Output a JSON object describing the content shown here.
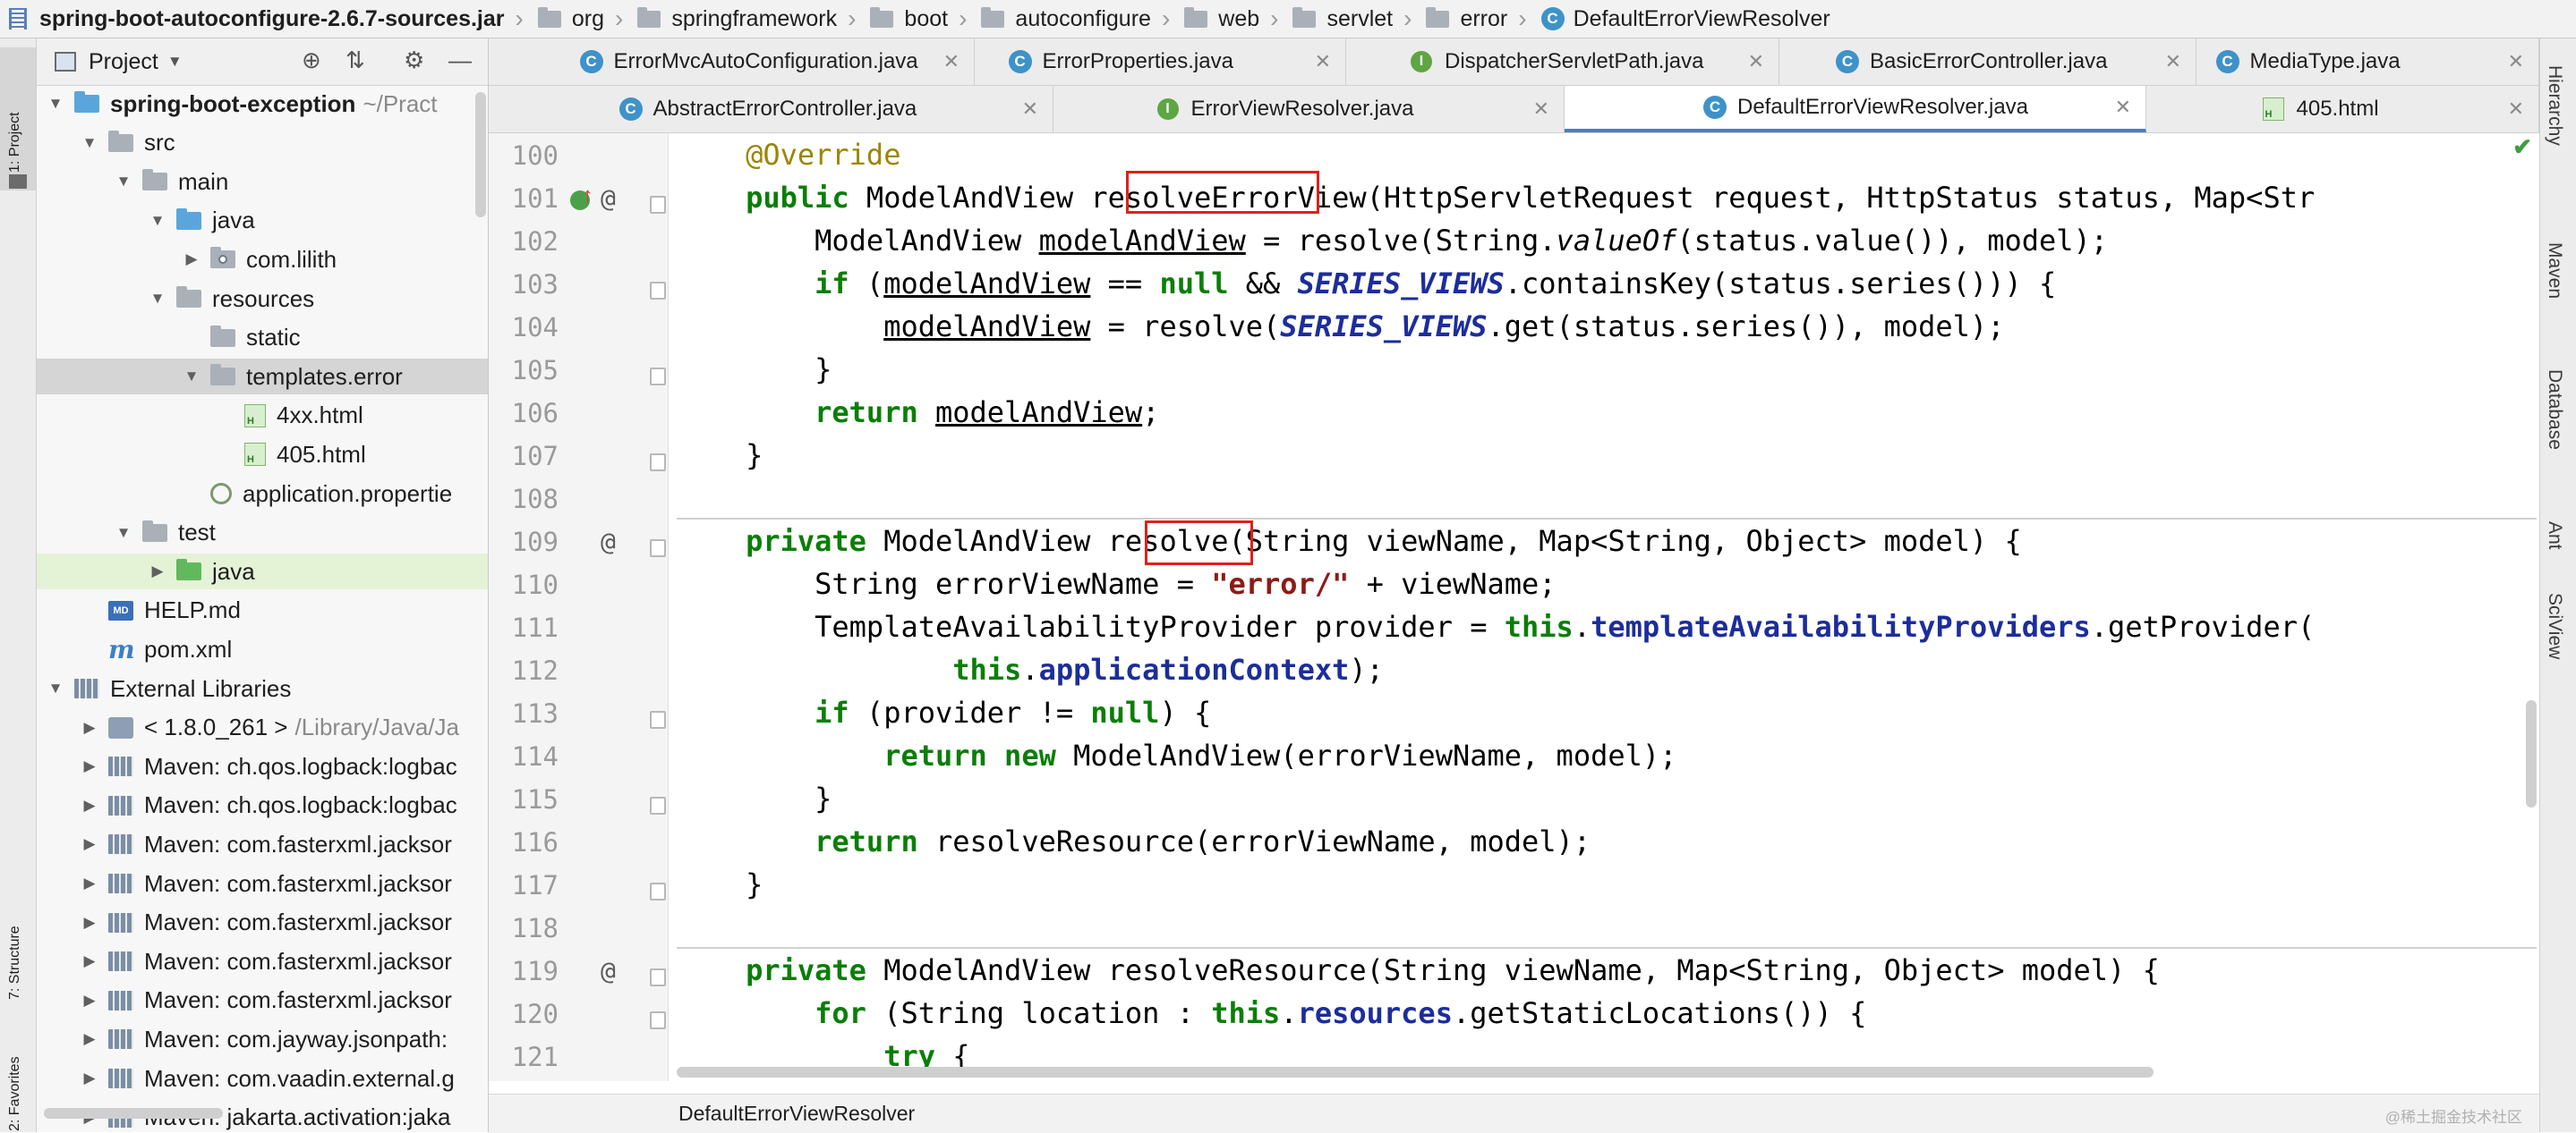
{
  "breadcrumb": [
    "spring-boot-autoconfigure-2.6.7-sources.jar",
    "org",
    "springframework",
    "boot",
    "autoconfigure",
    "web",
    "servlet",
    "error",
    "DefaultErrorViewResolver"
  ],
  "left_tools": [
    "1: Project",
    "7: Structure",
    "2: Favorites"
  ],
  "right_tools": [
    "Hierarchy",
    "Maven",
    "Database",
    "Ant",
    "SciView"
  ],
  "project": {
    "title": "Project",
    "tree": [
      {
        "label": "spring-boot-exception",
        "extra": "~/Pract",
        "icon": "module-folder-icon",
        "level": 0,
        "arrow": "down",
        "bold": true
      },
      {
        "label": "src",
        "icon": "folder-icon",
        "level": 1,
        "arrow": "down"
      },
      {
        "label": "main",
        "icon": "folder-icon",
        "level": 2,
        "arrow": "down"
      },
      {
        "label": "java",
        "icon": "source-folder-icon",
        "level": 3,
        "arrow": "down"
      },
      {
        "label": "com.lilith",
        "icon": "package-icon",
        "level": 4,
        "arrow": "right"
      },
      {
        "label": "resources",
        "icon": "resources-folder-icon",
        "level": 3,
        "arrow": "down"
      },
      {
        "label": "static",
        "icon": "folder-icon",
        "level": 4,
        "arrow": ""
      },
      {
        "label": "templates.error",
        "icon": "folder-icon",
        "level": 4,
        "arrow": "down",
        "selected": true
      },
      {
        "label": "4xx.html",
        "icon": "html-file-icon",
        "level": 5,
        "arrow": ""
      },
      {
        "label": "405.html",
        "icon": "html-file-icon",
        "level": 5,
        "arrow": ""
      },
      {
        "label": "application.propertie",
        "icon": "properties-file-icon",
        "level": 4,
        "arrow": ""
      },
      {
        "label": "test",
        "icon": "folder-icon",
        "level": 2,
        "arrow": "down"
      },
      {
        "label": "java",
        "icon": "test-folder-icon",
        "level": 3,
        "arrow": "right",
        "highlight": true
      },
      {
        "label": "HELP.md",
        "icon": "markdown-file-icon",
        "level": 1,
        "arrow": ""
      },
      {
        "label": "pom.xml",
        "icon": "maven-file-icon",
        "level": 1,
        "arrow": ""
      },
      {
        "label": "External Libraries",
        "icon": "library-icon",
        "level": 0,
        "arrow": "down"
      },
      {
        "label": "< 1.8.0_261 >",
        "extra": "/Library/Java/Ja",
        "icon": "jdk-icon",
        "level": 1,
        "arrow": "right"
      },
      {
        "label": "Maven: ch.qos.logback:logbac",
        "icon": "library-icon",
        "level": 1,
        "arrow": "right"
      },
      {
        "label": "Maven: ch.qos.logback:logbac",
        "icon": "library-icon",
        "level": 1,
        "arrow": "right"
      },
      {
        "label": "Maven: com.fasterxml.jacksor",
        "icon": "library-icon",
        "level": 1,
        "arrow": "right"
      },
      {
        "label": "Maven: com.fasterxml.jacksor",
        "icon": "library-icon",
        "level": 1,
        "arrow": "right"
      },
      {
        "label": "Maven: com.fasterxml.jacksor",
        "icon": "library-icon",
        "level": 1,
        "arrow": "right"
      },
      {
        "label": "Maven: com.fasterxml.jacksor",
        "icon": "library-icon",
        "level": 1,
        "arrow": "right"
      },
      {
        "label": "Maven: com.fasterxml.jacksor",
        "icon": "library-icon",
        "level": 1,
        "arrow": "right"
      },
      {
        "label": "Maven: com.jayway.jsonpath:",
        "icon": "library-icon",
        "level": 1,
        "arrow": "right"
      },
      {
        "label": "Maven: com.vaadin.external.g",
        "icon": "library-icon",
        "level": 1,
        "arrow": "right"
      },
      {
        "label": "Maven: jakarta.activation:jaka",
        "icon": "library-icon",
        "level": 1,
        "arrow": "right"
      }
    ]
  },
  "tabs_row1": [
    {
      "label": "ErrorMvcAutoConfiguration.java",
      "kind": "class"
    },
    {
      "label": "ErrorProperties.java",
      "kind": "class"
    },
    {
      "label": "DispatcherServletPath.java",
      "kind": "interface"
    },
    {
      "label": "BasicErrorController.java",
      "kind": "class"
    },
    {
      "label": "MediaType.java",
      "kind": "class"
    }
  ],
  "tabs_row2": [
    {
      "label": "AbstractErrorController.java",
      "kind": "class"
    },
    {
      "label": "ErrorViewResolver.java",
      "kind": "interface"
    },
    {
      "label": "DefaultErrorViewResolver.java",
      "kind": "class",
      "active": true
    },
    {
      "label": "405.html",
      "kind": "html"
    }
  ],
  "line_numbers": [
    "100",
    "101",
    "102",
    "103",
    "104",
    "105",
    "106",
    "107",
    "108",
    "109",
    "110",
    "111",
    "112",
    "113",
    "114",
    "115",
    "116",
    "117",
    "118",
    "119",
    "120",
    "121"
  ],
  "code": [
    [
      {
        "t": "    "
      },
      {
        "t": "@Override",
        "c": "ann"
      }
    ],
    [
      {
        "t": "    "
      },
      {
        "t": "public",
        "c": "kwb"
      },
      {
        "t": " ModelAndView resolveErrorView(HttpServletRequest request, HttpStatus status, Map<Str"
      }
    ],
    [
      {
        "t": "        ModelAndView "
      },
      {
        "t": "modelAndView",
        "c": "und"
      },
      {
        "t": " = resolve(String."
      },
      {
        "t": "valueOf",
        "c": "ital"
      },
      {
        "t": "(status.value()), model);"
      }
    ],
    [
      {
        "t": "        "
      },
      {
        "t": "if",
        "c": "kwb"
      },
      {
        "t": " ("
      },
      {
        "t": "modelAndView",
        "c": "und"
      },
      {
        "t": " == "
      },
      {
        "t": "null",
        "c": "kwb"
      },
      {
        "t": " && "
      },
      {
        "t": "SERIES_VIEWS",
        "c": "sfld"
      },
      {
        "t": ".containsKey(status.series())) {"
      }
    ],
    [
      {
        "t": "            "
      },
      {
        "t": "modelAndView",
        "c": "und"
      },
      {
        "t": " = resolve("
      },
      {
        "t": "SERIES_VIEWS",
        "c": "sfld"
      },
      {
        "t": ".get(status.series()), model);"
      }
    ],
    [
      {
        "t": "        }"
      }
    ],
    [
      {
        "t": "        "
      },
      {
        "t": "return",
        "c": "kwb"
      },
      {
        "t": " "
      },
      {
        "t": "modelAndView",
        "c": "und"
      },
      {
        "t": ";"
      }
    ],
    [
      {
        "t": "    }"
      }
    ],
    [
      {
        "t": ""
      }
    ],
    [
      {
        "t": "    "
      },
      {
        "t": "private",
        "c": "kwb"
      },
      {
        "t": " ModelAndView resolve(String viewName, Map<String, Object> model) {"
      }
    ],
    [
      {
        "t": "        String errorViewName = "
      },
      {
        "t": "\"error/\"",
        "c": "str"
      },
      {
        "t": " + viewName;"
      }
    ],
    [
      {
        "t": "        TemplateAvailabilityProvider provider = "
      },
      {
        "t": "this",
        "c": "kwb"
      },
      {
        "t": "."
      },
      {
        "t": "templateAvailabilityProviders",
        "c": "fld"
      },
      {
        "t": ".getProvider("
      }
    ],
    [
      {
        "t": "                "
      },
      {
        "t": "this",
        "c": "kwb"
      },
      {
        "t": "."
      },
      {
        "t": "applicationContext",
        "c": "fld"
      },
      {
        "t": ");"
      }
    ],
    [
      {
        "t": "        "
      },
      {
        "t": "if",
        "c": "kwb"
      },
      {
        "t": " (provider != "
      },
      {
        "t": "null",
        "c": "kwb"
      },
      {
        "t": ") {"
      }
    ],
    [
      {
        "t": "            "
      },
      {
        "t": "return new",
        "c": "kwb"
      },
      {
        "t": " ModelAndView(errorViewName, model);"
      }
    ],
    [
      {
        "t": "        }"
      }
    ],
    [
      {
        "t": "        "
      },
      {
        "t": "return",
        "c": "kwb"
      },
      {
        "t": " resolveResource(errorViewName, model);"
      }
    ],
    [
      {
        "t": "    }"
      }
    ],
    [
      {
        "t": ""
      }
    ],
    [
      {
        "t": "    "
      },
      {
        "t": "private",
        "c": "kwb"
      },
      {
        "t": " ModelAndView resolveResource(String viewName, Map<String, Object> model) {"
      }
    ],
    [
      {
        "t": "        "
      },
      {
        "t": "for",
        "c": "kwb"
      },
      {
        "t": " (String location : "
      },
      {
        "t": "this",
        "c": "kwb"
      },
      {
        "t": "."
      },
      {
        "t": "resources",
        "c": "fld"
      },
      {
        "t": ".getStaticLocations()) {"
      }
    ],
    [
      {
        "t": "            "
      },
      {
        "t": "try",
        "c": "kwb"
      },
      {
        "t": " {"
      }
    ]
  ],
  "status_bar": {
    "breadcrumb": "DefaultErrorViewResolver"
  },
  "watermark": "@稀土掘金技术社区",
  "colors": {
    "keyword": "#0a7e07",
    "annotation": "#9b8600",
    "field": "#1c2d9b",
    "string": "#8c1b17",
    "highlight_box": "#e0201a",
    "active_tab": "#4083c9"
  }
}
